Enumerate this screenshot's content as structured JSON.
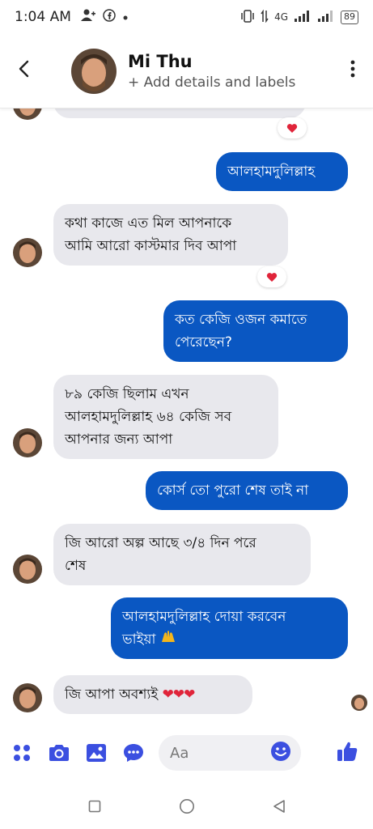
{
  "status_bar": {
    "time": "1:04 AM",
    "network": "4G",
    "battery": "89"
  },
  "header": {
    "contact_name": "Mi Thu",
    "subtitle": "+ Add details and labels"
  },
  "messages": [
    {
      "direction": "out",
      "text": "আলহামদুলিল্লাহ"
    },
    {
      "direction": "in",
      "lines": [
        "কথা কাজে এত মিল আপনাকে",
        "আমি আরো কাস্টমার দিব আপা"
      ],
      "reaction": "heart"
    },
    {
      "direction": "out",
      "lines": [
        "কত কেজি ওজন কমাতে",
        "পেরেছেন?"
      ]
    },
    {
      "direction": "in",
      "lines": [
        "৮৯ কেজি ছিলাম এখন",
        "আলহামদুলিল্লাহ ৬৪ কেজি সব",
        "আপনার জন্য আপা"
      ]
    },
    {
      "direction": "out",
      "text": "কোর্স তো পুরো শেষ তাই না"
    },
    {
      "direction": "in",
      "lines": [
        "জি আরো অল্প আছে ৩/৪ দিন পরে",
        "শেষ"
      ]
    },
    {
      "direction": "out",
      "lines": [
        "আলহামদুলিল্লাহ দোয়া করবেন",
        "ভাইয়া"
      ],
      "emoji": "raised-hands"
    },
    {
      "direction": "in",
      "text": "জি আপা অবশ্যই",
      "emoji_text": "❤❤❤"
    }
  ],
  "composer": {
    "placeholder": "Aa",
    "icons": [
      "apps-icon",
      "camera-icon",
      "gallery-icon",
      "chat-bubble-icon",
      "emoji-icon",
      "thumbs-up-icon"
    ]
  },
  "colors": {
    "outgoing_bubble": "#0a57c2",
    "incoming_bubble": "#e8e8ed",
    "accent": "#3b4fe0",
    "reaction_heart": "#e0243a"
  }
}
